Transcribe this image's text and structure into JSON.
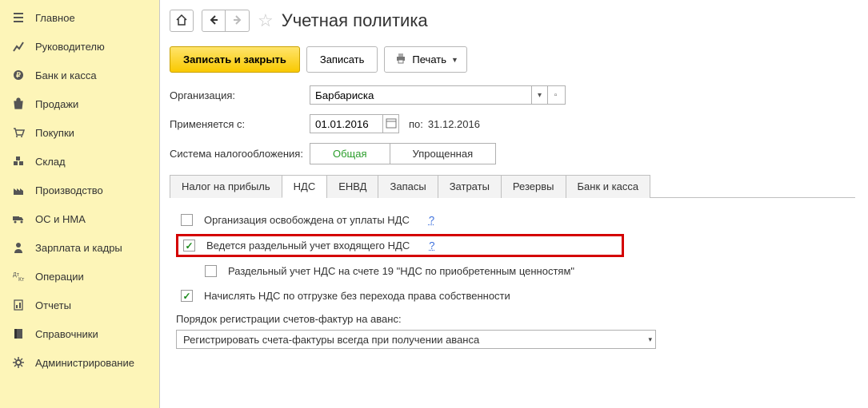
{
  "sidebar": {
    "items": [
      {
        "label": "Главное",
        "icon": "menu"
      },
      {
        "label": "Руководителю",
        "icon": "chart"
      },
      {
        "label": "Банк и касса",
        "icon": "ruble"
      },
      {
        "label": "Продажи",
        "icon": "bag"
      },
      {
        "label": "Покупки",
        "icon": "cart"
      },
      {
        "label": "Склад",
        "icon": "boxes"
      },
      {
        "label": "Производство",
        "icon": "factory"
      },
      {
        "label": "ОС и НМА",
        "icon": "truck"
      },
      {
        "label": "Зарплата и кадры",
        "icon": "person"
      },
      {
        "label": "Операции",
        "icon": "ops"
      },
      {
        "label": "Отчеты",
        "icon": "report"
      },
      {
        "label": "Справочники",
        "icon": "book"
      },
      {
        "label": "Администрирование",
        "icon": "gear"
      }
    ]
  },
  "header": {
    "title": "Учетная политика"
  },
  "toolbar": {
    "save_close": "Записать и закрыть",
    "save": "Записать",
    "print": "Печать"
  },
  "form": {
    "org_label": "Организация:",
    "org_value": "Барбариска",
    "applies_label": "Применяется с:",
    "applies_value": "01.01.2016",
    "to_label": "по:",
    "to_value": "31.12.2016",
    "tax_sys_label": "Система налогообложения:",
    "tax_sys_opts": {
      "general": "Общая",
      "simplified": "Упрощенная"
    }
  },
  "tabs": [
    "Налог на прибыль",
    "НДС",
    "ЕНВД",
    "Запасы",
    "Затраты",
    "Резервы",
    "Банк и касса"
  ],
  "nds": {
    "exempt": "Организация освобождена от уплаты НДС",
    "separate": "Ведется раздельный учет входящего НДС",
    "sep_account": "Раздельный учет НДС на счете 19 \"НДС по приобретенным ценностям\"",
    "charge_ship": "Начислять НДС по отгрузке без перехода права собственности",
    "invoice_order_label": "Порядок регистрации счетов-фактур на аванс:",
    "invoice_order_value": "Регистрировать счета-фактуры всегда при получении аванса",
    "help": "?"
  }
}
